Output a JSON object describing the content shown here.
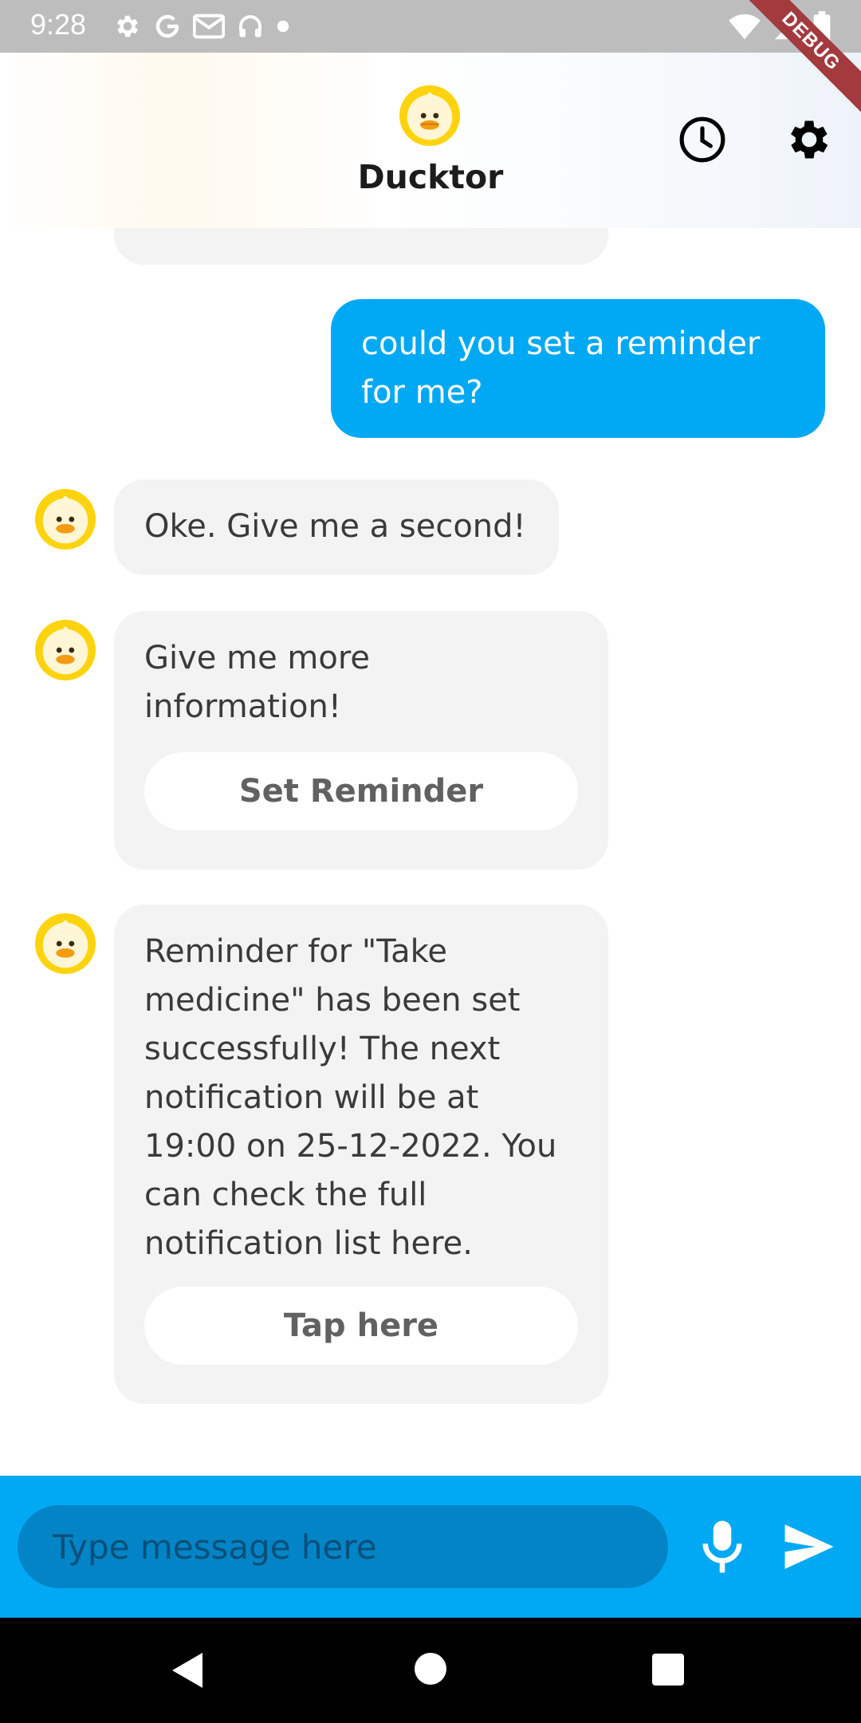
{
  "status_bar": {
    "time": "9:28",
    "left_icons": [
      "gear-icon",
      "google-icon",
      "gmail-icon",
      "headset-icon",
      "dot-icon"
    ],
    "right_icons": [
      "wifi-icon",
      "signal-icon",
      "battery-icon"
    ],
    "debug_banner": "DEBUG"
  },
  "app_bar": {
    "title": "Ducktor",
    "logo_icon": "duck-logo-icon",
    "actions": [
      {
        "name": "history",
        "icon": "clock-icon"
      },
      {
        "name": "settings",
        "icon": "gear-icon"
      }
    ]
  },
  "chat": {
    "messages": [
      {
        "from": "bot",
        "text": "",
        "partially_visible": true
      },
      {
        "from": "user",
        "text": "could you set a reminder for me?"
      },
      {
        "from": "bot",
        "text": "Oke. Give me a second!"
      },
      {
        "from": "bot",
        "text": "Give me more information!",
        "button": "Set Reminder"
      },
      {
        "from": "bot",
        "text": "Reminder for \"Take medicine\" has been set successfully! The next notification will be at 19:00 on 25-12-2022. You can check the full notification list here.",
        "button": "Tap here"
      }
    ]
  },
  "input": {
    "placeholder": "Type message here",
    "value": "",
    "mic_icon": "microphone-icon",
    "send_icon": "send-icon"
  },
  "nav_bar": {
    "buttons": [
      "back-icon",
      "home-icon",
      "recents-icon"
    ]
  },
  "colors": {
    "accent": "#01a9f4",
    "input_bg": "#0284c7",
    "bot_bubble": "#f3f3f3",
    "duck_yellow": "#fdd30e",
    "duck_beak": "#f39c12",
    "status_bar": "#bdbdbd",
    "debug_banner": "#a33a3e"
  }
}
